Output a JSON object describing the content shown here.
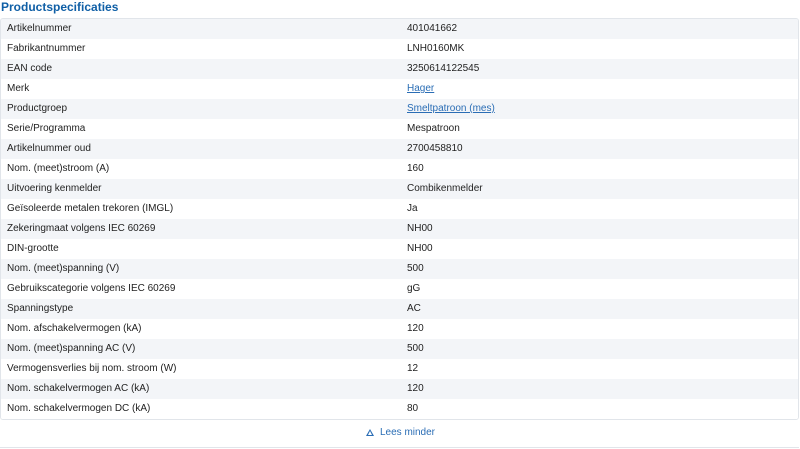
{
  "section": {
    "title": "Productspecificaties"
  },
  "specs": [
    {
      "label": "Artikelnummer",
      "value": "401041662"
    },
    {
      "label": "Fabrikantnummer",
      "value": "LNH0160MK"
    },
    {
      "label": "EAN code",
      "value": "3250614122545"
    },
    {
      "label": "Merk",
      "value": "Hager"
    },
    {
      "label": "Productgroep",
      "value": "Smeltpatroon (mes)"
    },
    {
      "label": "Serie/Programma",
      "value": "Mespatroon"
    },
    {
      "label": "Artikelnummer oud",
      "value": "2700458810"
    },
    {
      "label": "Nom. (meet)stroom (A)",
      "value": "160"
    },
    {
      "label": "Uitvoering kenmelder",
      "value": "Combikenmelder"
    },
    {
      "label": "Geïsoleerde metalen trekoren (IMGL)",
      "value": "Ja"
    },
    {
      "label": "Zekeringmaat volgens IEC 60269",
      "value": "NH00"
    },
    {
      "label": "DIN-grootte",
      "value": "NH00"
    },
    {
      "label": "Nom. (meet)spanning (V)",
      "value": "500"
    },
    {
      "label": "Gebruikscategorie volgens IEC 60269",
      "value": "gG"
    },
    {
      "label": "Spanningstype",
      "value": "AC"
    },
    {
      "label": "Nom. afschakelvermogen (kA)",
      "value": "120"
    },
    {
      "label": "Nom. (meet)spanning AC (V)",
      "value": "500"
    },
    {
      "label": "Vermogensverlies bij nom. stroom (W)",
      "value": "12"
    },
    {
      "label": "Nom. schakelvermogen AC (kA)",
      "value": "120"
    },
    {
      "label": "Nom. schakelvermogen DC (kA)",
      "value": "80"
    }
  ],
  "footer": {
    "toggle_label": "Lees minder",
    "toggle_icon": "triangle-up-icon"
  },
  "colors": {
    "accent": "#0f5fa6",
    "link": "#2a6db5",
    "row_alt": "#f3f5f8",
    "border": "#e1e5ea"
  }
}
